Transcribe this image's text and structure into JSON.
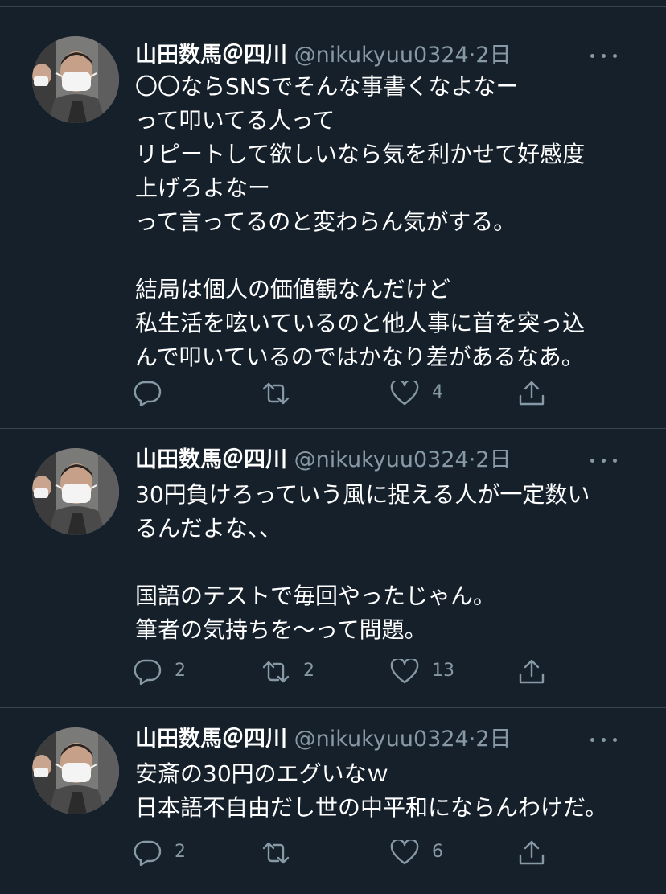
{
  "feed": {
    "tweets": [
      {
        "author": {
          "name": "山田数馬＠四川",
          "handle": "@nikukyuu0324"
        },
        "dot": "·",
        "time": "2日",
        "text": "〇〇ならSNSでそんな事書くなよなー\nって叩いてる人って\nリピートして欲しいなら気を利かせて好感度\n上げろよなー\nって言ってるのと変わらん気がする。\n\n結局は個人の価値観なんだけど\n私生活を呟いているのと他人事に首を突っ込\nんで叩いているのではかなり差があるなあ。",
        "replies": "",
        "retweets": "",
        "likes": "4"
      },
      {
        "author": {
          "name": "山田数馬＠四川",
          "handle": "@nikukyuu0324"
        },
        "dot": "·",
        "time": "2日",
        "text": "30円負けろっていう風に捉える人が一定数い\nるんだよな、、\n\n国語のテストで毎回やったじゃん。\n筆者の気持ちを〜って問題。",
        "replies": "2",
        "retweets": "2",
        "likes": "13"
      },
      {
        "author": {
          "name": "山田数馬＠四川",
          "handle": "@nikukyuu0324"
        },
        "dot": "·",
        "time": "2日",
        "text": "安斎の30円のエグいなｗ\n日本語不自由だし世の中平和にならんわけだ。",
        "replies": "2",
        "retweets": "",
        "likes": "6"
      }
    ]
  },
  "colors": {
    "background": "#15202b",
    "divider": "#38444d",
    "secondary_text": "#8899a6",
    "primary_text": "#ffffff"
  },
  "icons": {
    "reply": "reply-icon",
    "retweet": "retweet-icon",
    "like": "like-icon",
    "share": "share-icon",
    "more": "more-icon"
  }
}
